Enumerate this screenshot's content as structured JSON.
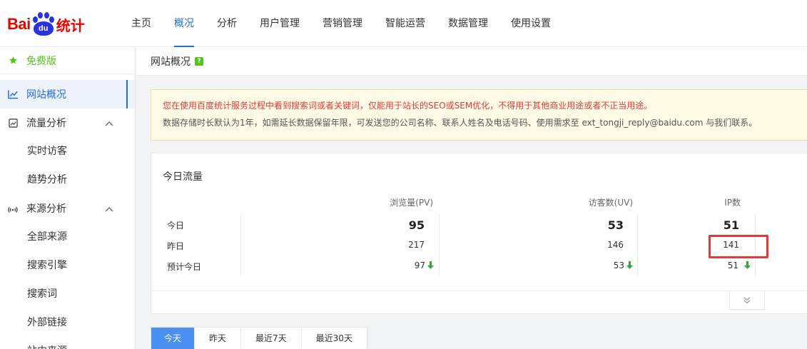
{
  "header": {
    "logo_text_left": "Bai",
    "logo_text_paw": "du",
    "logo_text_right": "统计",
    "nav": [
      {
        "label": "主页",
        "active": false
      },
      {
        "label": "概况",
        "active": true
      },
      {
        "label": "分析",
        "active": false
      },
      {
        "label": "用户管理",
        "active": false
      },
      {
        "label": "营销管理",
        "active": false
      },
      {
        "label": "智能运营",
        "active": false
      },
      {
        "label": "数据管理",
        "active": false
      },
      {
        "label": "使用设置",
        "active": false
      }
    ]
  },
  "sidebar": {
    "free_label": "免费版",
    "overview_label": "网站概况",
    "traffic_group": "流量分析",
    "traffic_items": [
      "实时访客",
      "趋势分析"
    ],
    "source_group": "来源分析",
    "source_items": [
      "全部来源",
      "搜索引擎",
      "搜索词",
      "外部链接",
      "站内来源"
    ]
  },
  "breadcrumb": {
    "title": "网站概况",
    "help": "?"
  },
  "notice": {
    "line1": "您在使用百度统计服务过程中看到搜索词或者关键词，仅能用于站长的SEO或SEM优化，不得用于其他商业用途或者不正当用途。",
    "line2": "数据存储时长默认为1年，如需延长数据保留年限，可发送您的公司名称、联系人姓名及电话号码、使用需求至 ext_tongji_reply@baidu.com 与我们联系。"
  },
  "traffic": {
    "title": "今日流量",
    "columns": [
      "浏览量(PV)",
      "访客数(UV)",
      "IP数"
    ],
    "rows": [
      {
        "label": "今日",
        "values": [
          "95",
          "53",
          "51"
        ],
        "trend": false
      },
      {
        "label": "昨日",
        "values": [
          "217",
          "146",
          "141"
        ],
        "trend": false
      },
      {
        "label": "预计今日",
        "values": [
          "97",
          "53",
          "51"
        ],
        "trend": true
      }
    ],
    "trend_color": "#3aa23a",
    "highlight_color": "#e53935"
  },
  "date_tabs": [
    {
      "label": "今天",
      "active": true
    },
    {
      "label": "昨天",
      "active": false
    },
    {
      "label": "最近7天",
      "active": false
    },
    {
      "label": "最近30天",
      "active": false
    }
  ]
}
